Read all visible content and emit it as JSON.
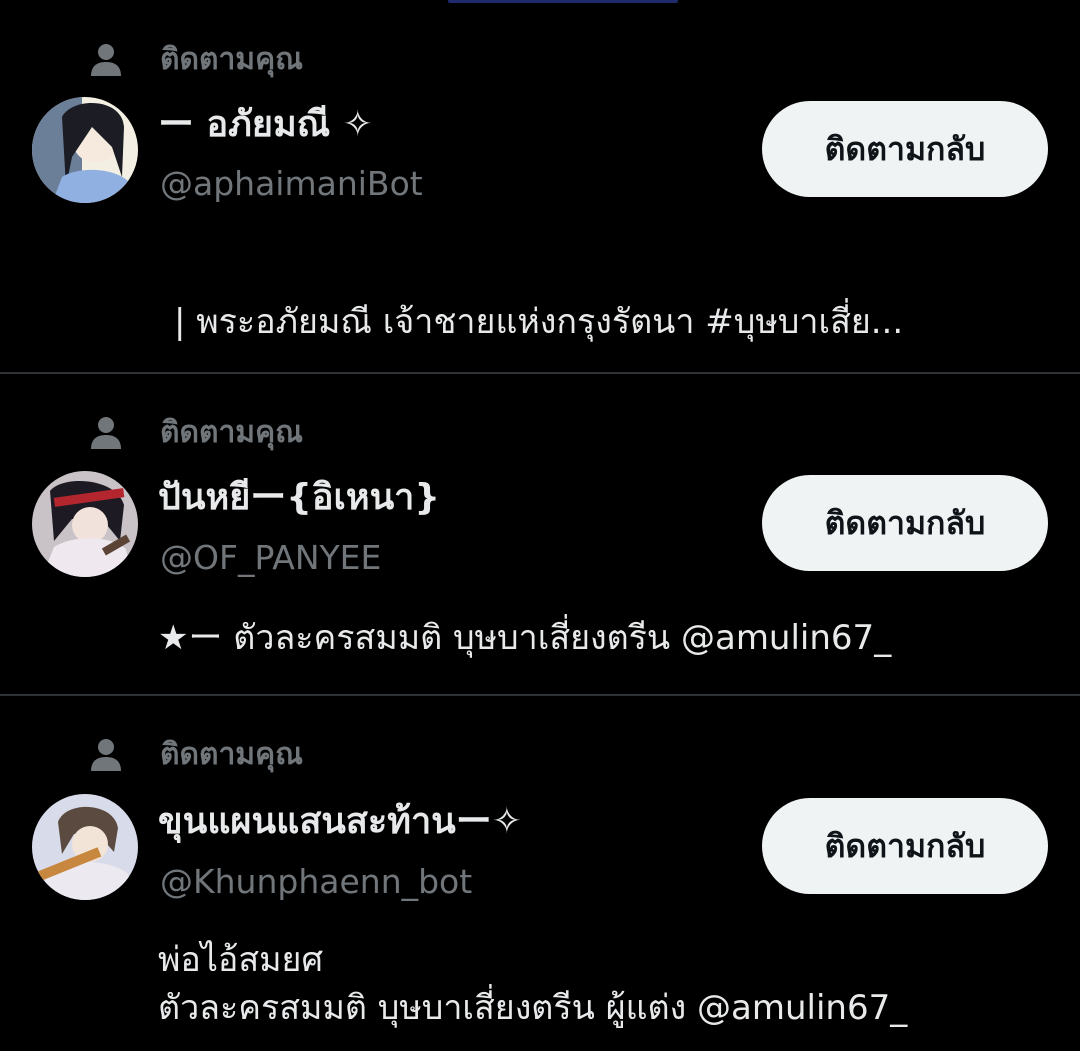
{
  "feed": {
    "items": [
      {
        "follows_label": "ติดตามคุณ",
        "display_name": "ー อภัยมณี ✧",
        "handle": "@aphaimaniBot",
        "button_label": "ติดตามกลับ",
        "bio_lines": [
          "| พระอภัยมณี เจ้าชายแห่งกรุงรัตนา   #บุษบาเสี่ย..."
        ]
      },
      {
        "follows_label": "ติดตามคุณ",
        "display_name": "ปันหยีー{อิเหนา}",
        "handle": "@OF_PANYEE",
        "button_label": "ติดตามกลับ",
        "bio_lines": [
          "★ー ตัวละครสมมติ บุษบาเสี่ยงตรีน @amulin67_"
        ]
      },
      {
        "follows_label": "ติดตามคุณ",
        "display_name": "ขุนแผนแสนสะท้านー✧",
        "handle": "@Khunphaenn_bot",
        "button_label": "ติดตามกลับ",
        "bio_lines": [
          "พ่อไอ้สมยศ",
          "ตัวละครสมมติ บุษบาเสี่ยงตรีน ผู้แต่ง @amulin67_"
        ]
      }
    ]
  },
  "icons": {
    "follows_indicator": "person-icon"
  },
  "colors": {
    "background": "#000000",
    "primary_text": "#e7e9ea",
    "secondary_text": "#71767b",
    "button_bg": "#eff3f4",
    "button_text": "#0f1419",
    "divider": "#2f3336"
  }
}
